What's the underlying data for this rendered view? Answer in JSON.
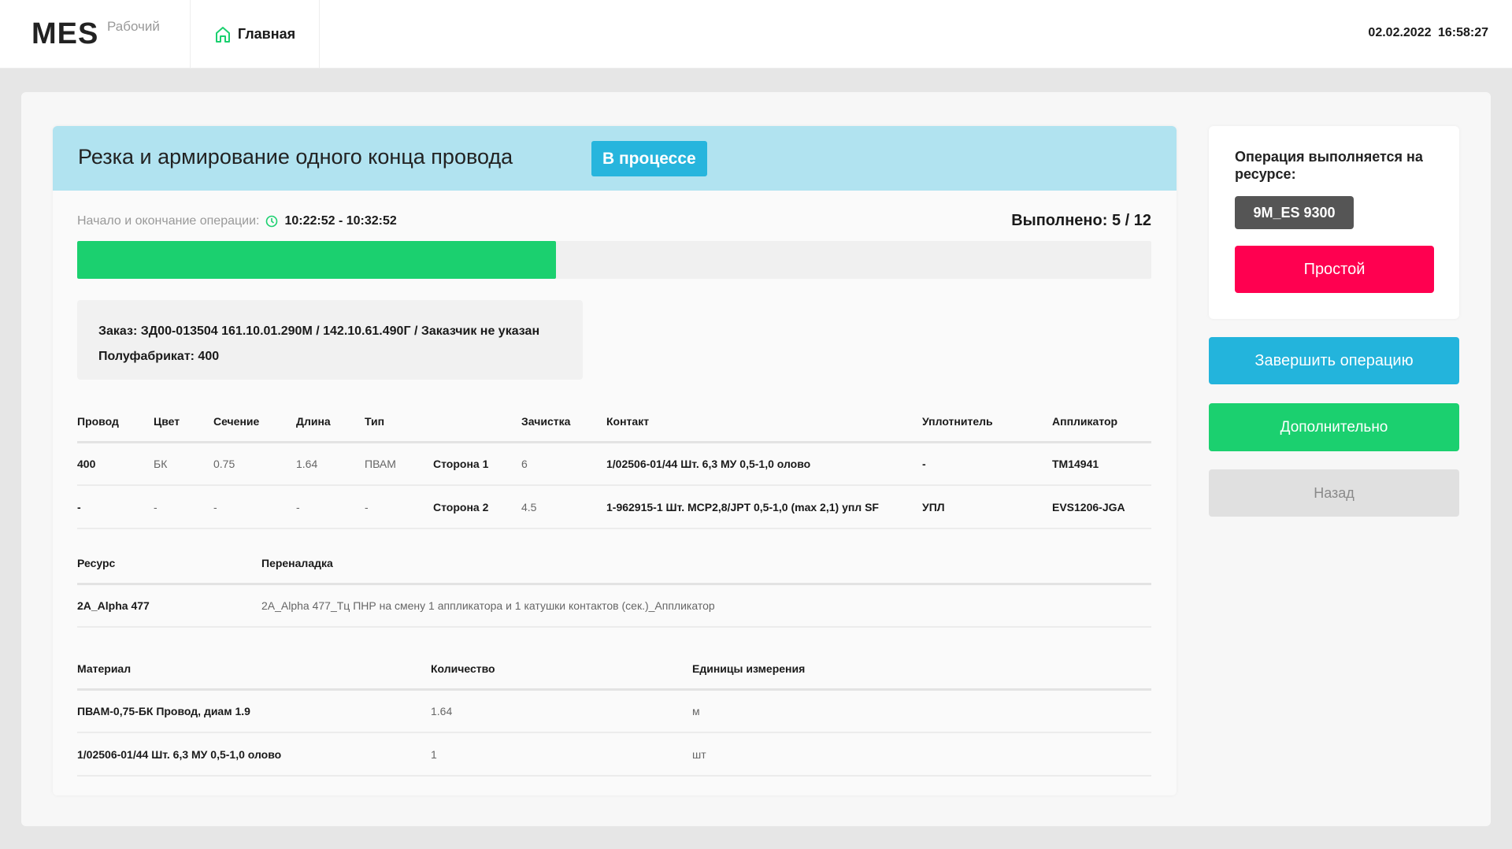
{
  "header": {
    "logo": "MES",
    "logo_sub": "Рабочий",
    "nav_home": "Главная",
    "date": "02.02.2022",
    "time": "16:58:27"
  },
  "operation": {
    "title": "Резка и армирование одного конца провода",
    "status": "В процессе",
    "time_label": "Начало и окончание операции:",
    "time_range": "10:22:52 - 10:32:52",
    "done_label": "Выполнено: 5 / 12",
    "progress_fill": 0.446,
    "order": "Заказ: ЗД00-013504 161.10.01.290М / 142.10.61.490Г / Заказчик не указан",
    "semi": "Полуфабрикат: 400"
  },
  "wires": {
    "headers": [
      "Провод",
      "Цвет",
      "Сечение",
      "Длина",
      "Тип",
      "",
      "Зачистка",
      "Контакт",
      "Уплотнитель",
      "Аппликатор"
    ],
    "rows": [
      [
        "400",
        "БК",
        "0.75",
        "1.64",
        "ПВАМ",
        "Сторона 1",
        "6",
        "1/02506-01/44 Шт. 6,3 МУ 0,5-1,0 олово",
        "-",
        "TM14941"
      ],
      [
        "-",
        "-",
        "-",
        "-",
        "-",
        "Сторона 2",
        "4.5",
        "1-962915-1 Шт. MCP2,8/JPT 0,5-1,0 (max 2,1) упл SF",
        "УПЛ",
        "EVS1206-JGA"
      ]
    ]
  },
  "resources": {
    "headers": [
      "Ресурс",
      "Переналадка"
    ],
    "rows": [
      [
        "2A_Alpha 477",
        "2A_Alpha 477_Тц ПНР на смену 1 аппликатора и 1 катушки контактов (сек.)_Аппликатор"
      ]
    ]
  },
  "materials": {
    "headers": [
      "Материал",
      "Количество",
      "Единицы измерения"
    ],
    "rows": [
      [
        "ПВАМ-0,75-БК Провод, диам 1.9",
        "1.64",
        "м"
      ],
      [
        "1/02506-01/44 Шт. 6,3 МУ 0,5-1,0 олово",
        "1",
        "шт"
      ]
    ]
  },
  "side": {
    "resource_title": "Операция выполняется на ресурсе:",
    "resource_chip": "9M_ES 9300",
    "idle": "Простой",
    "finish": "Завершить операцию",
    "more": "Дополнительно",
    "back": "Назад"
  },
  "colors": {
    "accent": "#27b5dd",
    "green": "#1bd06f",
    "red": "#ff0050",
    "head_bg": "#b1e3f0"
  }
}
